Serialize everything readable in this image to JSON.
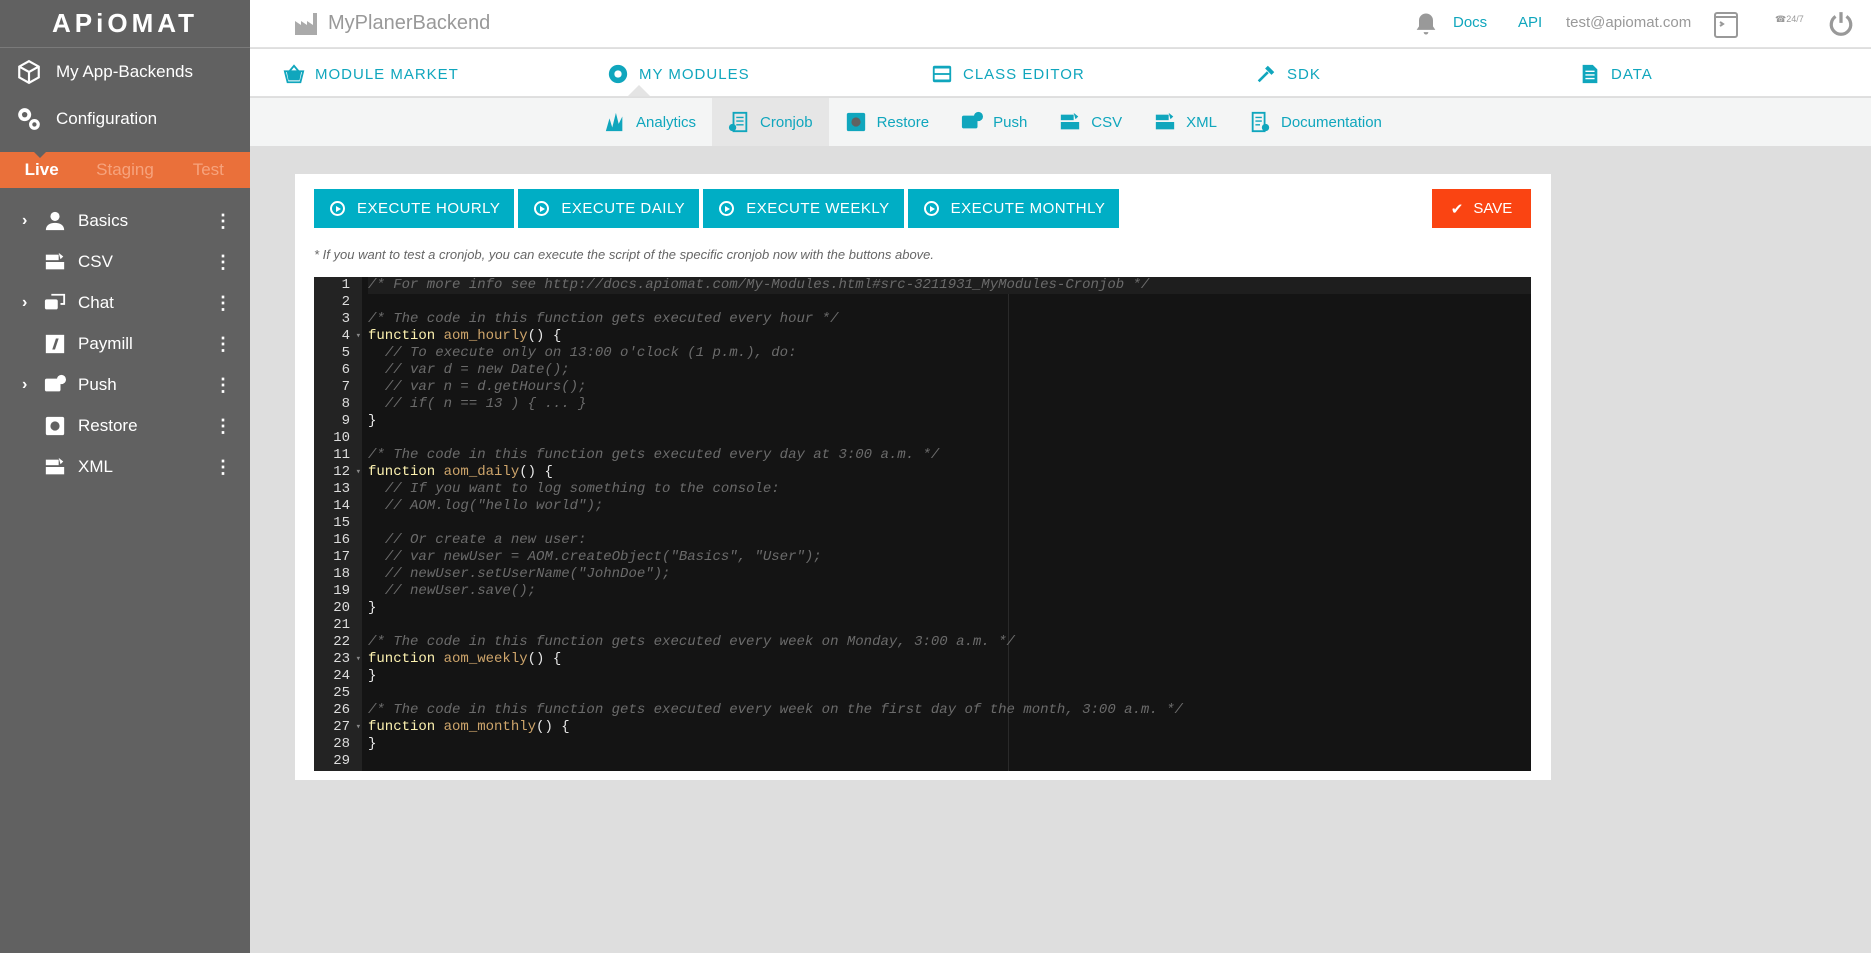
{
  "sidebar": {
    "logo": "APiOMAT",
    "top": [
      {
        "label": "My App-Backends",
        "icon": "cube-icon"
      },
      {
        "label": "Configuration",
        "icon": "gears-icon"
      }
    ],
    "environments": [
      {
        "label": "Live",
        "active": true
      },
      {
        "label": "Staging",
        "active": false
      },
      {
        "label": "Test",
        "active": false
      }
    ],
    "modules": [
      {
        "label": "Basics",
        "icon": "user-icon",
        "expandable": true
      },
      {
        "label": "CSV",
        "icon": "csv-icon",
        "expandable": false
      },
      {
        "label": "Chat",
        "icon": "chat-icon",
        "expandable": true
      },
      {
        "label": "Paymill",
        "icon": "paymill-icon",
        "expandable": false
      },
      {
        "label": "Push",
        "icon": "push-icon",
        "expandable": true
      },
      {
        "label": "Restore",
        "icon": "restore-icon",
        "expandable": false
      },
      {
        "label": "XML",
        "icon": "xml-icon",
        "expandable": false
      }
    ]
  },
  "header": {
    "app_title": "MyPlanerBackend",
    "docs": "Docs",
    "api": "API",
    "user": "test@apiomat.com",
    "support": "24/7"
  },
  "mainnav": [
    {
      "label": "MODULE MARKET",
      "icon": "basket-icon"
    },
    {
      "label": "MY MODULES",
      "icon": "gear-icon",
      "active": true
    },
    {
      "label": "CLASS EDITOR",
      "icon": "class-editor-icon"
    },
    {
      "label": "SDK",
      "icon": "tools-icon"
    },
    {
      "label": "DATA",
      "icon": "document-icon"
    }
  ],
  "subnav": [
    {
      "label": "Analytics",
      "icon": "analytics-icon"
    },
    {
      "label": "Cronjob",
      "icon": "cronjob-icon",
      "active": true
    },
    {
      "label": "Restore",
      "icon": "restore-icon"
    },
    {
      "label": "Push",
      "icon": "push-icon"
    },
    {
      "label": "CSV",
      "icon": "csv-icon"
    },
    {
      "label": "XML",
      "icon": "xml-icon"
    },
    {
      "label": "Documentation",
      "icon": "documentation-icon"
    }
  ],
  "cronjob": {
    "buttons": [
      "EXECUTE HOURLY",
      "EXECUTE DAILY",
      "EXECUTE WEEKLY",
      "EXECUTE MONTHLY"
    ],
    "save": "SAVE",
    "note": "* If you want to test a cronjob, you can execute the script of the specific cronjob now with the buttons above."
  },
  "colors": {
    "accent": "#00aec5",
    "env_bar": "#ea703a",
    "save": "#fa4412",
    "sidebar": "#616161"
  },
  "code": [
    [
      [
        "cm",
        "/* For more info see http://docs.apiomat.com/My-Modules.html#src-3211931_MyModules-Cronjob */"
      ]
    ],
    [],
    [
      [
        "cm",
        "/* The code in this function gets executed every hour */"
      ]
    ],
    [
      [
        "kw",
        "function"
      ],
      [
        "pl",
        " "
      ],
      [
        "fn",
        "aom_hourly"
      ],
      [
        "pl",
        "() {"
      ]
    ],
    [
      [
        "pl",
        "  "
      ],
      [
        "cm",
        "// To execute only on 13:00 o'clock (1 p.m.), do:"
      ]
    ],
    [
      [
        "pl",
        "  "
      ],
      [
        "cm",
        "// var d = new Date();"
      ]
    ],
    [
      [
        "pl",
        "  "
      ],
      [
        "cm",
        "// var n = d.getHours();"
      ]
    ],
    [
      [
        "pl",
        "  "
      ],
      [
        "cm",
        "// if( n == 13 ) { ... }"
      ]
    ],
    [
      [
        "pl",
        "}"
      ]
    ],
    [],
    [
      [
        "cm",
        "/* The code in this function gets executed every day at 3:00 a.m. */"
      ]
    ],
    [
      [
        "kw",
        "function"
      ],
      [
        "pl",
        " "
      ],
      [
        "fn",
        "aom_daily"
      ],
      [
        "pl",
        "() {"
      ]
    ],
    [
      [
        "pl",
        "  "
      ],
      [
        "cm",
        "// If you want to log something to the console:"
      ]
    ],
    [
      [
        "pl",
        "  "
      ],
      [
        "cm",
        "// AOM.log(\"hello world\");"
      ]
    ],
    [],
    [
      [
        "pl",
        "  "
      ],
      [
        "cm",
        "// Or create a new user:"
      ]
    ],
    [
      [
        "pl",
        "  "
      ],
      [
        "cm",
        "// var newUser = AOM.createObject(\"Basics\", \"User\");"
      ]
    ],
    [
      [
        "pl",
        "  "
      ],
      [
        "cm",
        "// newUser.setUserName(\"JohnDoe\");"
      ]
    ],
    [
      [
        "pl",
        "  "
      ],
      [
        "cm",
        "// newUser.save();"
      ]
    ],
    [
      [
        "pl",
        "}"
      ]
    ],
    [],
    [
      [
        "cm",
        "/* The code in this function gets executed every week on Monday, 3:00 a.m. */"
      ]
    ],
    [
      [
        "kw",
        "function"
      ],
      [
        "pl",
        " "
      ],
      [
        "fn",
        "aom_weekly"
      ],
      [
        "pl",
        "() {"
      ]
    ],
    [
      [
        "pl",
        "}"
      ]
    ],
    [],
    [
      [
        "cm",
        "/* The code in this function gets executed every week on the first day of the month, 3:00 a.m. */"
      ]
    ],
    [
      [
        "kw",
        "function"
      ],
      [
        "pl",
        " "
      ],
      [
        "fn",
        "aom_monthly"
      ],
      [
        "pl",
        "() {"
      ]
    ],
    [
      [
        "pl",
        "}"
      ]
    ],
    []
  ]
}
